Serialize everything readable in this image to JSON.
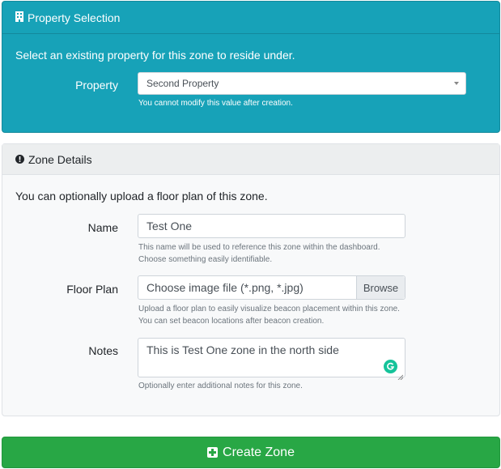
{
  "property_card": {
    "title": "Property Selection",
    "icon": "building-icon",
    "intro": "Select an existing property for this zone to reside under.",
    "property_label": "Property",
    "property_value": "Second Property",
    "property_help": "You cannot modify this value after creation."
  },
  "zone_card": {
    "title": "Zone Details",
    "icon": "info-circle-icon",
    "intro": "You can optionally upload a floor plan of this zone.",
    "name_label": "Name",
    "name_value": "Test One",
    "name_help_1": "This name will be used to reference this zone within the dashboard.",
    "name_help_2": "Choose something easily identifiable.",
    "floor_label": "Floor Plan",
    "floor_placeholder": "Choose image file (*.png, *.jpg)",
    "browse_label": "Browse",
    "floor_help_1": "Upload a floor plan to easily visualize beacon placement within this zone.",
    "floor_help_2": "You can set beacon locations after beacon creation.",
    "notes_label": "Notes",
    "notes_value": "This is Test One zone in the north side",
    "notes_help": "Optionally enter additional notes for this zone."
  },
  "create_button": {
    "label": "Create Zone",
    "icon": "plus-square-icon"
  },
  "colors": {
    "teal": "#17a2b8",
    "green": "#28a745",
    "grammarly": "#15c39a"
  }
}
